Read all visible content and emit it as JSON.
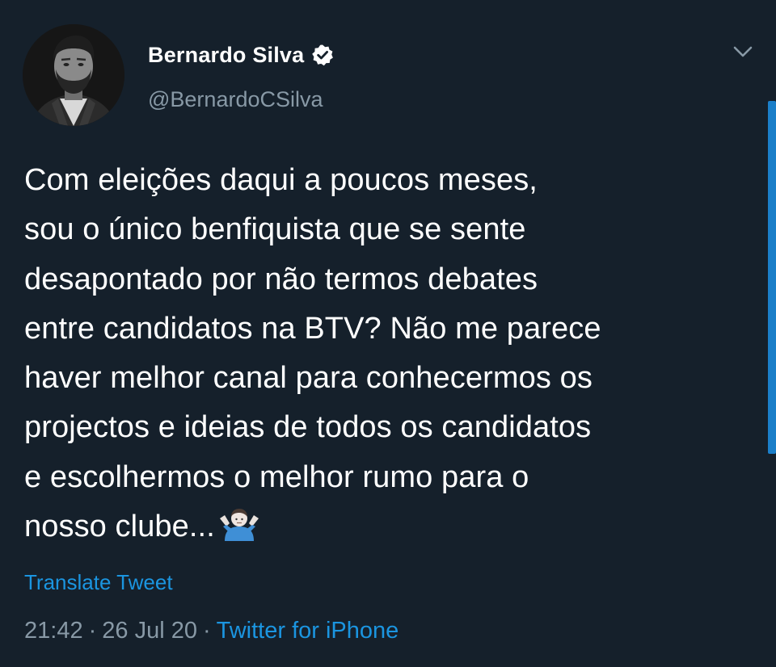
{
  "author": {
    "display_name": "Bernardo Silva",
    "handle": "@BernardoCSilva",
    "verified": true
  },
  "tweet": {
    "lines": [
      "Com eleições daqui a poucos meses,",
      "sou o único benfiquista que se sente",
      "desapontado por não termos debates",
      "entre candidatos na BTV? Não me parece",
      "haver melhor canal para conhecermos os",
      "projectos e ideias de todos os candidatos",
      "e escolhermos o melhor rumo para o",
      "nosso clube..."
    ],
    "trailing_emoji": "man-shrugging-emoji"
  },
  "actions": {
    "translate_label": "Translate Tweet"
  },
  "meta": {
    "time": "21:42",
    "date": "26 Jul 20",
    "separator": "·",
    "source": "Twitter for iPhone"
  },
  "colors": {
    "background": "#15202b",
    "text": "#ffffff",
    "secondary": "#8899a6",
    "link": "#1b95e0"
  }
}
